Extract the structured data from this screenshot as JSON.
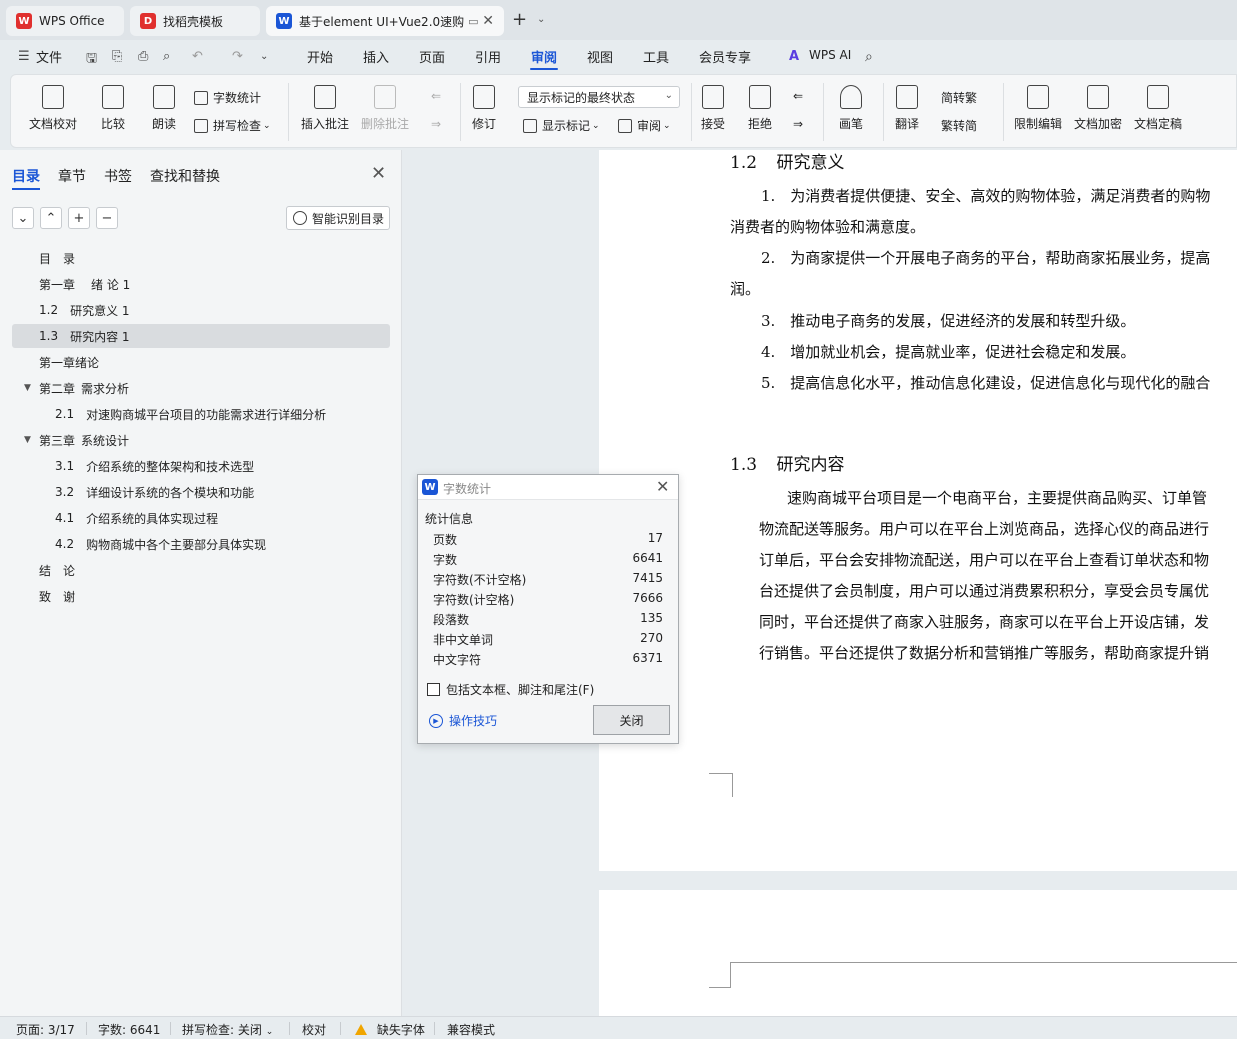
{
  "tabs": [
    {
      "label": "WPS Office",
      "color": "#e0302e"
    },
    {
      "label": "找稻壳模板",
      "color": "#e0302e"
    },
    {
      "label": "基于element UI+Vue2.0速购",
      "color": "#1b56d6"
    }
  ],
  "menu": {
    "file": "文件",
    "items": [
      "开始",
      "插入",
      "页面",
      "引用",
      "审阅",
      "视图",
      "工具",
      "会员专享"
    ],
    "active": "审阅",
    "wps_ai": "WPS AI"
  },
  "ribbon": {
    "proofread": "文档校对",
    "compare": "比较",
    "read_aloud": "朗读",
    "word_count": "字数统计",
    "spell_check": "拼写检查",
    "insert_comment": "插入批注",
    "delete_comment": "删除批注",
    "revise": "修订",
    "markup_combo": "显示标记的最终状态",
    "show_markup": "显示标记",
    "review": "审阅",
    "accept": "接受",
    "reject": "拒绝",
    "brush": "画笔",
    "translate": "翻译",
    "to_traditional": "简转繁",
    "to_simplified": "繁转简",
    "restrict_edit": "限制编辑",
    "encrypt": "文档加密",
    "finalize": "文档定稿"
  },
  "nav": {
    "tabs": [
      "目录",
      "章节",
      "书签",
      "查找和替换"
    ],
    "smart_toc": "智能识别目录",
    "toc": [
      {
        "num": "目",
        "text": "录",
        "level": 1
      },
      {
        "num": "第一章",
        "text": "绪 论 1",
        "level": 1
      },
      {
        "num": "1.2",
        "text": "研究意义 1",
        "level": 1
      },
      {
        "num": "1.3",
        "text": "研究内容 1",
        "level": 1,
        "selected": true
      },
      {
        "num": "",
        "text": "第一章绪论",
        "level": 1
      },
      {
        "num": "第二章",
        "text": "需求分析",
        "level": 1,
        "expanded": true
      },
      {
        "num": "2.1",
        "text": "对速购商城平台项目的功能需求进行详细分析",
        "level": 2
      },
      {
        "num": "第三章",
        "text": "系统设计",
        "level": 1,
        "expanded": true
      },
      {
        "num": "3.1",
        "text": "介绍系统的整体架构和技术选型",
        "level": 2
      },
      {
        "num": "3.2",
        "text": "详细设计系统的各个模块和功能",
        "level": 2
      },
      {
        "num": "4.1",
        "text": "介绍系统的具体实现过程",
        "level": 2
      },
      {
        "num": "4.2",
        "text": "购物商城中各个主要部分具体实现",
        "level": 2
      },
      {
        "num": "结",
        "text": "论",
        "level": 1
      },
      {
        "num": "致",
        "text": "谢",
        "level": 1
      }
    ]
  },
  "doc": {
    "h12_num": "1.2",
    "h12_title": "研究意义",
    "p1": "1.　为消费者提供便捷、安全、高效的购物体验，满足消费者的购物",
    "p1b": "消费者的购物体验和满意度。",
    "p2": "2.　为商家提供一个开展电子商务的平台，帮助商家拓展业务，提高",
    "p2b": "润。",
    "p3": "3.　推动电子商务的发展，促进经济的发展和转型升级。",
    "p4": "4.　增加就业机会，提高就业率，促进社会稳定和发展。",
    "p5": "5.　提高信息化水平，推动信息化建设，促进信息化与现代化的融合",
    "h13_num": "1.3",
    "h13_title": "研究内容",
    "c1": "速购商城平台项目是一个电商平台，主要提供商品购买、订单管",
    "c2": "物流配送等服务。用户可以在平台上浏览商品，选择心仪的商品进行",
    "c3": "订单后，平台会安排物流配送，用户可以在平台上查看订单状态和物",
    "c4": "台还提供了会员制度，用户可以通过消费累积积分，享受会员专属优",
    "c5": "同时，平台还提供了商家入驻服务，商家可以在平台上开设店铺，发",
    "c6": "行销售。平台还提供了数据分析和营销推广等服务，帮助商家提升销"
  },
  "dialog": {
    "title": "字数统计",
    "group": "统计信息",
    "stats": [
      {
        "label": "页数",
        "value": "17"
      },
      {
        "label": "字数",
        "value": "6641"
      },
      {
        "label": "字符数(不计空格)",
        "value": "7415"
      },
      {
        "label": "字符数(计空格)",
        "value": "7666"
      },
      {
        "label": "段落数",
        "value": "135"
      },
      {
        "label": "非中文单词",
        "value": "270"
      },
      {
        "label": "中文字符",
        "value": "6371"
      }
    ],
    "include_label": "包括文本框、脚注和尾注(F)",
    "tips": "操作技巧",
    "close": "关闭"
  },
  "status": {
    "page": "页面: 3/17",
    "words": "字数: 6641",
    "spell": "拼写检查: 关闭",
    "proof": "校对",
    "missing_font": "缺失字体",
    "compat": "兼容模式"
  }
}
